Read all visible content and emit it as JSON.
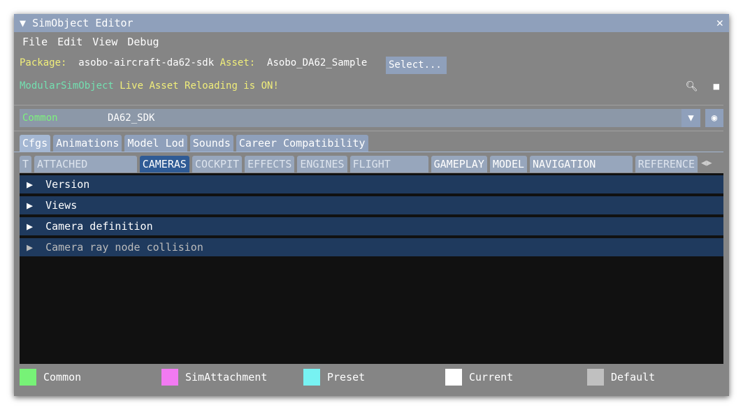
{
  "title": "SimObject Editor",
  "menu": [
    "File",
    "Edit",
    "View",
    "Debug"
  ],
  "package_label": "Package:",
  "package": "asobo-aircraft-da62-sdk",
  "asset_label": "Asset:",
  "asset": "Asobo_DA62_Sample",
  "select": "Select...",
  "modular": "ModularSimObject",
  "reload": "Live Asset Reloading is ON!",
  "combo": {
    "type": "Common",
    "value": "DA62_SDK"
  },
  "tabs": [
    "Cfgs",
    "Animations",
    "Model Lod",
    "Sounds",
    "Career Compatibility"
  ],
  "subtabs": [
    "T",
    "ATTACHED OBJECTS",
    "CAMERAS",
    "COCKPIT",
    "EFFECTS",
    "ENGINES",
    "FLIGHT MODEL",
    "GAMEPLAY",
    "MODEL",
    "NAVIGATION GRAPH",
    "REFERENCE"
  ],
  "sections": [
    "Version",
    "Views",
    "Camera definition",
    "Camera ray node collision"
  ],
  "legend": [
    {
      "label": "Common",
      "color": "#77f277"
    },
    {
      "label": "SimAttachment",
      "color": "#f27af2"
    },
    {
      "label": "Preset",
      "color": "#77f2f2"
    },
    {
      "label": "Current",
      "color": "#ffffff"
    },
    {
      "label": "Default",
      "color": "#c0c0c0"
    }
  ]
}
